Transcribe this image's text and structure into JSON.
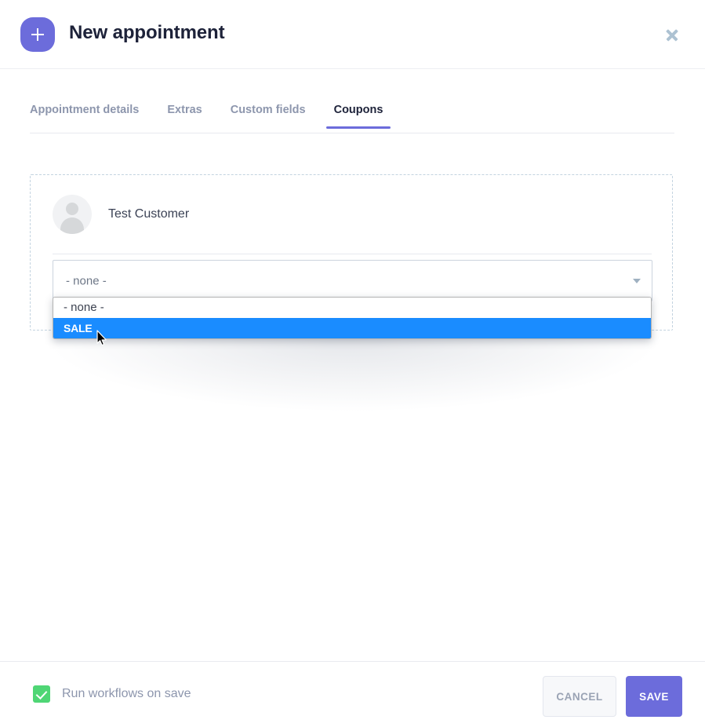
{
  "header": {
    "title": "New appointment",
    "add_icon": "plus-icon",
    "close_icon": "close-icon"
  },
  "tabs": [
    {
      "label": "Appointment details",
      "active": false
    },
    {
      "label": "Extras",
      "active": false
    },
    {
      "label": "Custom fields",
      "active": false
    },
    {
      "label": "Coupons",
      "active": true
    }
  ],
  "coupon_panel": {
    "customer": {
      "name": "Test Customer",
      "avatar_icon": "user-avatar-icon"
    },
    "coupon_select": {
      "value": "- none -",
      "arrow_icon": "chevron-down-icon",
      "options": [
        {
          "label": "- none -",
          "selected": false
        },
        {
          "label": "SALE",
          "selected": true
        }
      ]
    }
  },
  "footer": {
    "workflow_checkbox": {
      "label": "Run workflows on save",
      "checked": true
    },
    "cancel_label": "CANCEL",
    "save_label": "SAVE"
  },
  "colors": {
    "accent_purple": "#6c6cdb",
    "highlight_blue": "#1a8cff",
    "checkbox_green": "#4fd675",
    "title_dark": "#1d2239",
    "muted_text": "#8d96ad",
    "dashed_border": "#c3d3e0"
  }
}
